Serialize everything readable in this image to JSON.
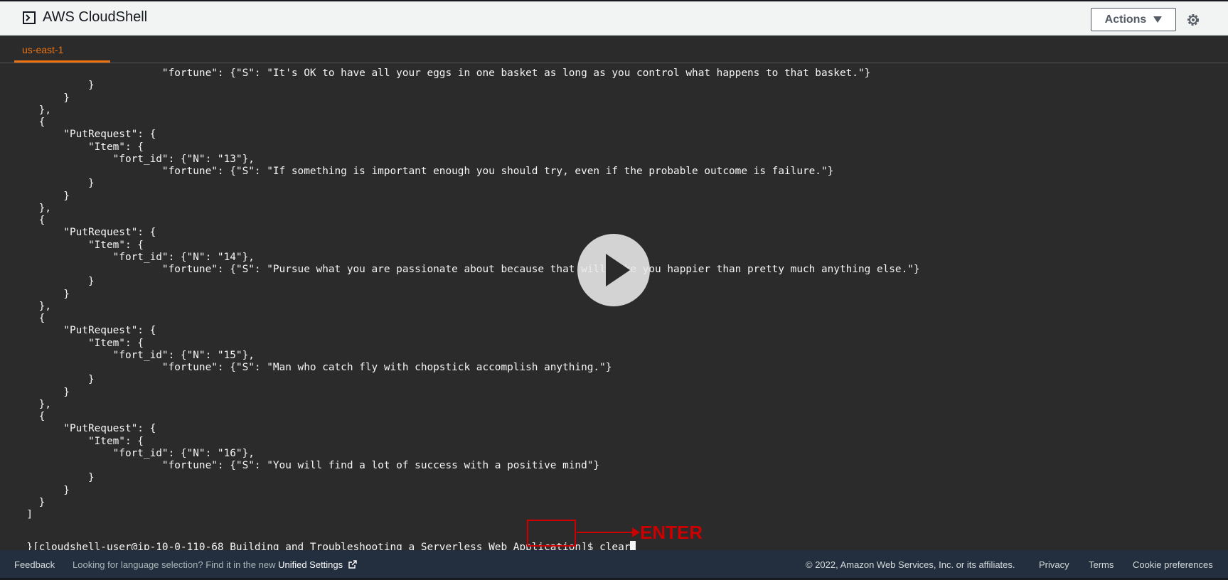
{
  "header": {
    "title": "AWS CloudShell",
    "actions_label": "Actions"
  },
  "tabs": [
    {
      "label": "us-east-1",
      "active": true
    }
  ],
  "terminal": {
    "lines": [
      "                        \"fortune\": {\"S\": \"It's OK to have all your eggs in one basket as long as you control what happens to that basket.\"}",
      "            }",
      "        }",
      "    },",
      "    {",
      "        \"PutRequest\": {",
      "            \"Item\": {",
      "                \"fort_id\": {\"N\": \"13\"},",
      "                        \"fortune\": {\"S\": \"If something is important enough you should try, even if the probable outcome is failure.\"}",
      "            }",
      "        }",
      "    },",
      "    {",
      "        \"PutRequest\": {",
      "            \"Item\": {",
      "                \"fort_id\": {\"N\": \"14\"},",
      "                        \"fortune\": {\"S\": \"Pursue what you are passionate about because that will make you happier than pretty much anything else.\"}",
      "            }",
      "        }",
      "    },",
      "    {",
      "        \"PutRequest\": {",
      "            \"Item\": {",
      "                \"fort_id\": {\"N\": \"15\"},",
      "                        \"fortune\": {\"S\": \"Man who catch fly with chopstick accomplish anything.\"}",
      "            }",
      "        }",
      "    },",
      "    {",
      "        \"PutRequest\": {",
      "            \"Item\": {",
      "                \"fort_id\": {\"N\": \"16\"},",
      "                        \"fortune\": {\"S\": \"You will find a lot of success with a positive mind\"}",
      "            }",
      "        }",
      "    }",
      "  ]"
    ],
    "prompt": "}[cloudshell-user@ip-10-0-110-68 Building_and_Troubleshooting_a_Serverless_Web_Application]$ ",
    "command": "clear"
  },
  "annotation": {
    "label": "ENTER",
    "color": "#cc0000"
  },
  "overlay": {
    "icon": "play-icon"
  },
  "footer": {
    "feedback": "Feedback",
    "hint_prefix": "Looking for language selection? Find it in the new ",
    "unified_settings": "Unified Settings",
    "copyright": "© 2022, Amazon Web Services, Inc. or its affiliates.",
    "privacy": "Privacy",
    "terms": "Terms",
    "cookie": "Cookie preferences"
  },
  "colors": {
    "accent": "#ec7211",
    "terminal_bg": "#2b2b2b",
    "footer_bg": "#232f3e"
  }
}
